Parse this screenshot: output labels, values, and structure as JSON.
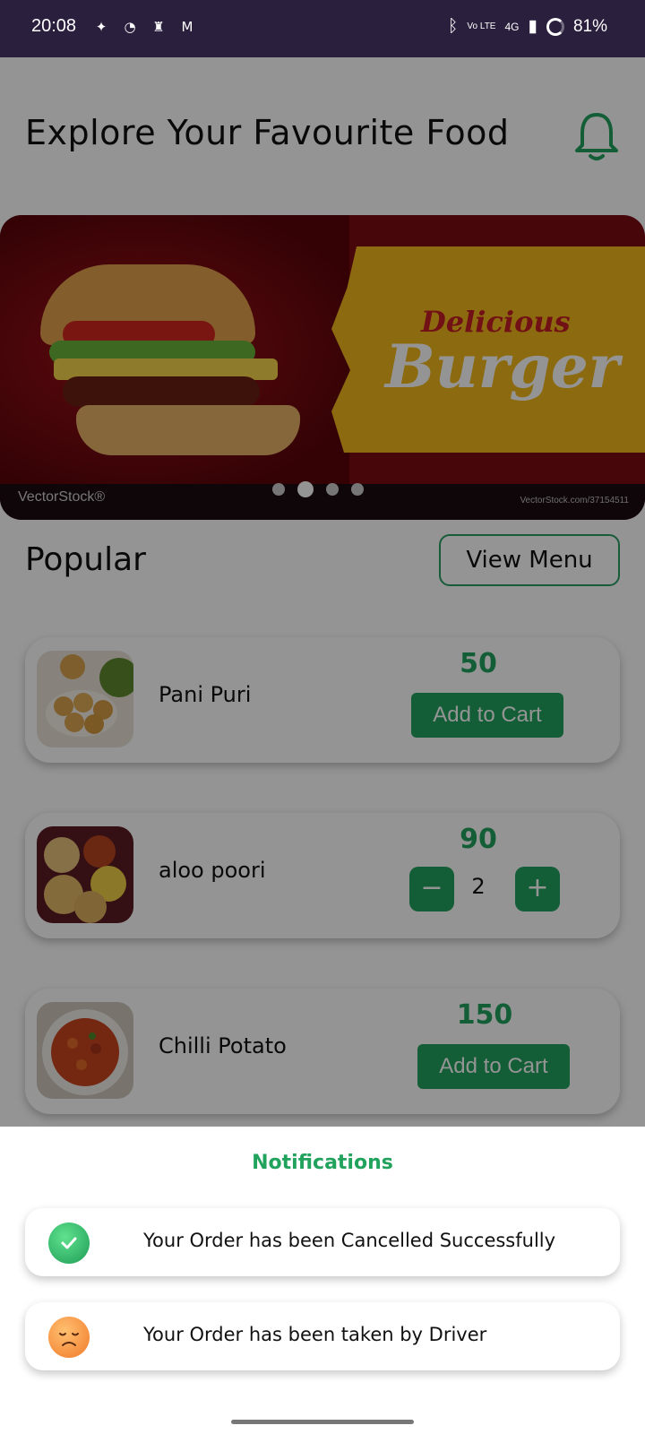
{
  "status_bar": {
    "time": "20:08",
    "left_icons": [
      "torch-icon",
      "pacman-icon",
      "chef-ready-icon",
      "gmail-icon"
    ],
    "network": "4G",
    "volte": "Vo LTE",
    "battery": "81%"
  },
  "header": {
    "title": "Explore Your Favourite Food",
    "bell_icon": "bell-icon"
  },
  "banner": {
    "text_line1": "Delicious",
    "text_line2": "Burger",
    "watermark": "VectorStock®",
    "url": "VectorStock.com/37154511",
    "active_slide": 2,
    "slide_count": 4
  },
  "popular": {
    "title": "Popular",
    "view_menu_label": "View Menu",
    "items": [
      {
        "name": "Pani Puri",
        "price": "50",
        "action": "Add to Cart"
      },
      {
        "name": "aloo poori",
        "price": "90",
        "quantity": "2"
      },
      {
        "name": "Chilli Potato",
        "price": "150",
        "action": "Add to Cart"
      }
    ]
  },
  "notifications": {
    "title": "Notifications",
    "items": [
      {
        "text": "Your Order has been Cancelled Successfully",
        "icon": "check-icon"
      },
      {
        "text": "Your Order has been taken by Driver",
        "icon": "sad-face-icon"
      }
    ]
  },
  "colors": {
    "accent_green": "#21a35e",
    "status_bar": "#2a1f3d"
  }
}
